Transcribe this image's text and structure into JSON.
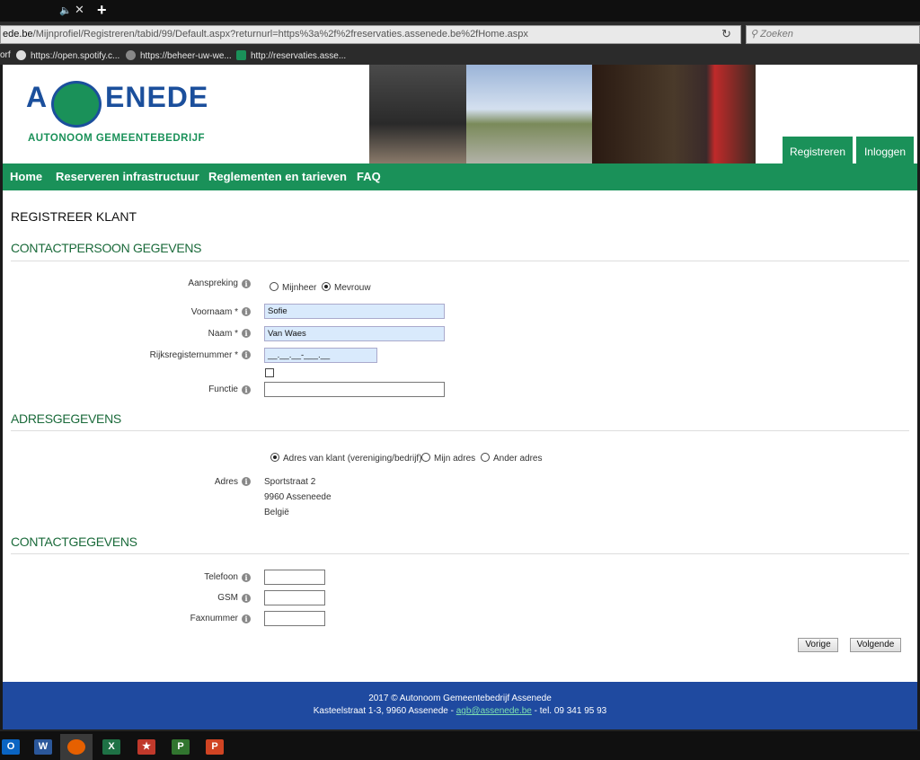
{
  "browser": {
    "sound_icon": "speaker-icon",
    "close_tab_glyph": "✕",
    "new_tab_glyph": "+",
    "url_host": "ede.be",
    "url_path": "/Mijnprofiel/Registreren/tabid/99/Default.aspx?returnurl=https%3a%2f%2freservaties.assenede.be%2fHome.aspx",
    "search_placeholder": "Zoeken",
    "bookmarks": [
      {
        "label": "orf"
      },
      {
        "label": "https://open.spotify.c..."
      },
      {
        "label": "https://beheer-uw-we..."
      },
      {
        "label": "http://reservaties.asse..."
      }
    ]
  },
  "header": {
    "logo_text_left": "A",
    "logo_text_right": "ENEDE",
    "logo_subtitle": "AUTONOOM GEMEENTEBEDRIJF",
    "register_label": "Registreren",
    "login_label": "Inloggen"
  },
  "menu": {
    "items": [
      {
        "label": "Home"
      },
      {
        "label": "Reserveren infrastructuur"
      },
      {
        "label": "Reglementen en tarieven"
      },
      {
        "label": "FAQ"
      }
    ]
  },
  "form": {
    "page_title": "REGISTREER KLANT",
    "section_contact_person": "CONTACTPERSOON GEGEVENS",
    "salutation_label": "Aanspreking",
    "salutation_options": [
      "Mijnheer",
      "Mevrouw"
    ],
    "salutation_selected": "Mevrouw",
    "firstname_label": "Voornaam *",
    "firstname_value": "Sofie",
    "lastname_label": "Naam *",
    "lastname_value": "Van Waes",
    "national_id_label": "Rijksregisternummer *",
    "national_id_value": "__.__.__-___.__",
    "function_label": "Functie",
    "function_value": "",
    "section_address": "ADRESGEGEVENS",
    "address_options": [
      "Adres van klant (vereniging/bedrijf)",
      "Mijn adres",
      "Ander adres"
    ],
    "address_selected": "Adres van klant (vereniging/bedrijf)",
    "address_label": "Adres",
    "address_lines": [
      "Sportstraat 2",
      "9960 Asseneede",
      "België"
    ],
    "section_contact": "CONTACTGEGEVENS",
    "phone_label": "Telefoon",
    "gsm_label": "GSM",
    "fax_label": "Faxnummer",
    "prev_button": "Vorige",
    "next_button": "Volgende"
  },
  "footer": {
    "line1": "2017 © Autonoom Gemeentebedrijf Assenede",
    "address_prefix": "Kasteelstraat 1-3, 9960 Assenede  - ",
    "email": "agb@assenede.be",
    "phone_suffix": " - tel. 09 341 95 93"
  },
  "taskbar": {
    "apps": [
      {
        "icon": "outlook-icon",
        "glyph": "O",
        "color": "#0a64c2"
      },
      {
        "icon": "word-icon",
        "glyph": "W",
        "color": "#2b579a"
      },
      {
        "icon": "firefox-icon",
        "glyph": "",
        "color": "#e66000"
      },
      {
        "icon": "excel-icon",
        "glyph": "X",
        "color": "#1e7145"
      },
      {
        "icon": "access-icon",
        "glyph": "★",
        "color": "#c0392b"
      },
      {
        "icon": "project-icon",
        "glyph": "P",
        "color": "#31752f"
      },
      {
        "icon": "powerpoint-icon",
        "glyph": "P",
        "color": "#d04423"
      }
    ]
  },
  "colors": {
    "brand_green": "#1a9159",
    "brand_blue": "#1f4aa0"
  }
}
